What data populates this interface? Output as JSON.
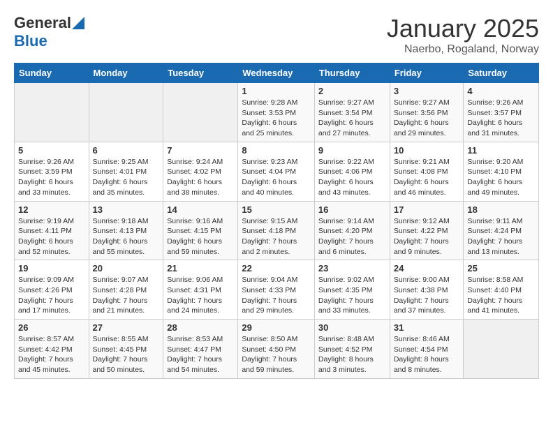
{
  "logo": {
    "general": "General",
    "blue": "Blue"
  },
  "title": {
    "month": "January 2025",
    "location": "Naerbo, Rogaland, Norway"
  },
  "days_of_week": [
    "Sunday",
    "Monday",
    "Tuesday",
    "Wednesday",
    "Thursday",
    "Friday",
    "Saturday"
  ],
  "weeks": [
    [
      {
        "day": "",
        "info": ""
      },
      {
        "day": "",
        "info": ""
      },
      {
        "day": "",
        "info": ""
      },
      {
        "day": "1",
        "info": "Sunrise: 9:28 AM\nSunset: 3:53 PM\nDaylight: 6 hours and 25 minutes."
      },
      {
        "day": "2",
        "info": "Sunrise: 9:27 AM\nSunset: 3:54 PM\nDaylight: 6 hours and 27 minutes."
      },
      {
        "day": "3",
        "info": "Sunrise: 9:27 AM\nSunset: 3:56 PM\nDaylight: 6 hours and 29 minutes."
      },
      {
        "day": "4",
        "info": "Sunrise: 9:26 AM\nSunset: 3:57 PM\nDaylight: 6 hours and 31 minutes."
      }
    ],
    [
      {
        "day": "5",
        "info": "Sunrise: 9:26 AM\nSunset: 3:59 PM\nDaylight: 6 hours and 33 minutes."
      },
      {
        "day": "6",
        "info": "Sunrise: 9:25 AM\nSunset: 4:01 PM\nDaylight: 6 hours and 35 minutes."
      },
      {
        "day": "7",
        "info": "Sunrise: 9:24 AM\nSunset: 4:02 PM\nDaylight: 6 hours and 38 minutes."
      },
      {
        "day": "8",
        "info": "Sunrise: 9:23 AM\nSunset: 4:04 PM\nDaylight: 6 hours and 40 minutes."
      },
      {
        "day": "9",
        "info": "Sunrise: 9:22 AM\nSunset: 4:06 PM\nDaylight: 6 hours and 43 minutes."
      },
      {
        "day": "10",
        "info": "Sunrise: 9:21 AM\nSunset: 4:08 PM\nDaylight: 6 hours and 46 minutes."
      },
      {
        "day": "11",
        "info": "Sunrise: 9:20 AM\nSunset: 4:10 PM\nDaylight: 6 hours and 49 minutes."
      }
    ],
    [
      {
        "day": "12",
        "info": "Sunrise: 9:19 AM\nSunset: 4:11 PM\nDaylight: 6 hours and 52 minutes."
      },
      {
        "day": "13",
        "info": "Sunrise: 9:18 AM\nSunset: 4:13 PM\nDaylight: 6 hours and 55 minutes."
      },
      {
        "day": "14",
        "info": "Sunrise: 9:16 AM\nSunset: 4:15 PM\nDaylight: 6 hours and 59 minutes."
      },
      {
        "day": "15",
        "info": "Sunrise: 9:15 AM\nSunset: 4:18 PM\nDaylight: 7 hours and 2 minutes."
      },
      {
        "day": "16",
        "info": "Sunrise: 9:14 AM\nSunset: 4:20 PM\nDaylight: 7 hours and 6 minutes."
      },
      {
        "day": "17",
        "info": "Sunrise: 9:12 AM\nSunset: 4:22 PM\nDaylight: 7 hours and 9 minutes."
      },
      {
        "day": "18",
        "info": "Sunrise: 9:11 AM\nSunset: 4:24 PM\nDaylight: 7 hours and 13 minutes."
      }
    ],
    [
      {
        "day": "19",
        "info": "Sunrise: 9:09 AM\nSunset: 4:26 PM\nDaylight: 7 hours and 17 minutes."
      },
      {
        "day": "20",
        "info": "Sunrise: 9:07 AM\nSunset: 4:28 PM\nDaylight: 7 hours and 21 minutes."
      },
      {
        "day": "21",
        "info": "Sunrise: 9:06 AM\nSunset: 4:31 PM\nDaylight: 7 hours and 24 minutes."
      },
      {
        "day": "22",
        "info": "Sunrise: 9:04 AM\nSunset: 4:33 PM\nDaylight: 7 hours and 29 minutes."
      },
      {
        "day": "23",
        "info": "Sunrise: 9:02 AM\nSunset: 4:35 PM\nDaylight: 7 hours and 33 minutes."
      },
      {
        "day": "24",
        "info": "Sunrise: 9:00 AM\nSunset: 4:38 PM\nDaylight: 7 hours and 37 minutes."
      },
      {
        "day": "25",
        "info": "Sunrise: 8:58 AM\nSunset: 4:40 PM\nDaylight: 7 hours and 41 minutes."
      }
    ],
    [
      {
        "day": "26",
        "info": "Sunrise: 8:57 AM\nSunset: 4:42 PM\nDaylight: 7 hours and 45 minutes."
      },
      {
        "day": "27",
        "info": "Sunrise: 8:55 AM\nSunset: 4:45 PM\nDaylight: 7 hours and 50 minutes."
      },
      {
        "day": "28",
        "info": "Sunrise: 8:53 AM\nSunset: 4:47 PM\nDaylight: 7 hours and 54 minutes."
      },
      {
        "day": "29",
        "info": "Sunrise: 8:50 AM\nSunset: 4:50 PM\nDaylight: 7 hours and 59 minutes."
      },
      {
        "day": "30",
        "info": "Sunrise: 8:48 AM\nSunset: 4:52 PM\nDaylight: 8 hours and 3 minutes."
      },
      {
        "day": "31",
        "info": "Sunrise: 8:46 AM\nSunset: 4:54 PM\nDaylight: 8 hours and 8 minutes."
      },
      {
        "day": "",
        "info": ""
      }
    ]
  ]
}
